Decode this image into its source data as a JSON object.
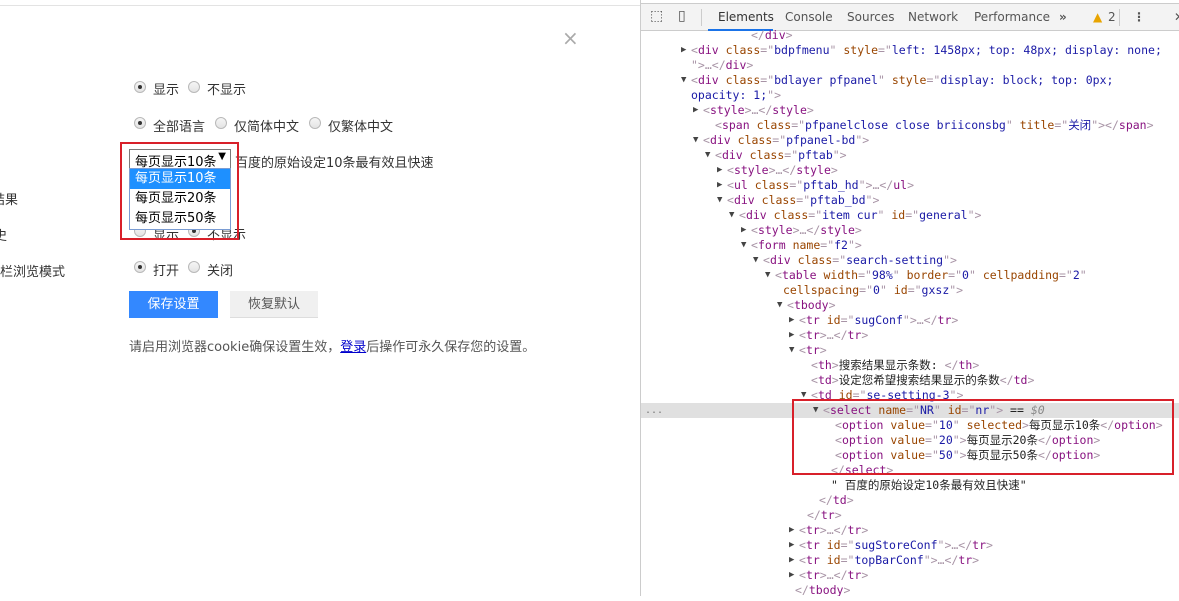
{
  "panel": {
    "close_icon": "×",
    "row_labels": [
      "结果",
      "史",
      "通栏浏览模式"
    ],
    "suggest": {
      "options": [
        "显示",
        "不显示"
      ],
      "selected": 0
    },
    "language": {
      "options": [
        "全部语言",
        "仅简体中文",
        "仅繁体中文"
      ],
      "selected": 0
    },
    "results_per_page": {
      "value": "每页显示10条",
      "options": [
        "每页显示10条",
        "每页显示20条",
        "每页显示50条"
      ],
      "highlighted": 0,
      "hint": "百度的原始设定10条最有效且快速"
    },
    "history": {
      "options": [
        "显示",
        "不显示"
      ],
      "selected": 1
    },
    "topbar": {
      "options": [
        "打开",
        "关闭"
      ],
      "selected": 0
    },
    "save_label": "保存设置",
    "reset_label": "恢复默认",
    "note_before": "请启用浏览器cookie确保设置生效，",
    "note_link": "登录",
    "note_after": "后操作可永久保存您的设置。",
    "highlight_color": "#d8202a"
  },
  "devtools": {
    "tabs": [
      "Elements",
      "Console",
      "Sources",
      "Network",
      "Performance"
    ],
    "active_tab": "Elements",
    "more": "»",
    "warnings": "2",
    "dots": "...",
    "lines": [
      {
        "i": 5,
        "a": "",
        "s": [
          [
            "p",
            "</"
          ],
          [
            "tag",
            "div"
          ],
          [
            "p",
            ">"
          ]
        ]
      },
      {
        "i": 0,
        "a": "r",
        "s": [
          [
            "p",
            "<"
          ],
          [
            "tag",
            "div "
          ],
          [
            "an",
            "class"
          ],
          [
            "p",
            "=\""
          ],
          [
            "av",
            "bdpfmenu"
          ],
          [
            "p",
            "\" "
          ],
          [
            "an",
            "style"
          ],
          [
            "p",
            "=\""
          ],
          [
            "av",
            "left: 1458px; top: 48px; display: none;"
          ]
        ]
      },
      {
        "i": 0,
        "a": "",
        "s": [
          [
            "p",
            "\">…</"
          ],
          [
            "tag",
            "div"
          ],
          [
            "p",
            ">"
          ]
        ]
      },
      {
        "i": 0,
        "a": "d",
        "s": [
          [
            "p",
            "<"
          ],
          [
            "tag",
            "div "
          ],
          [
            "an",
            "class"
          ],
          [
            "p",
            "=\""
          ],
          [
            "av",
            "bdlayer pfpanel"
          ],
          [
            "p",
            "\" "
          ],
          [
            "an",
            "style"
          ],
          [
            "p",
            "=\""
          ],
          [
            "av",
            "display: block; top: 0px;"
          ]
        ]
      },
      {
        "i": 0,
        "a": "",
        "s": [
          [
            "av",
            "opacity: 1;"
          ],
          [
            "p",
            "\">"
          ]
        ]
      },
      {
        "i": 1,
        "a": "r",
        "s": [
          [
            "p",
            "<"
          ],
          [
            "tag",
            "style"
          ],
          [
            "p",
            ">…</"
          ],
          [
            "tag",
            "style"
          ],
          [
            "p",
            ">"
          ]
        ]
      },
      {
        "i": 2,
        "a": "",
        "s": [
          [
            "p",
            "<"
          ],
          [
            "tag",
            "span "
          ],
          [
            "an",
            "class"
          ],
          [
            "p",
            "=\""
          ],
          [
            "av",
            "pfpanelclose close briiconsbg"
          ],
          [
            "p",
            "\" "
          ],
          [
            "an",
            "title"
          ],
          [
            "p",
            "=\""
          ],
          [
            "av",
            "关闭"
          ],
          [
            "p",
            "\"></"
          ],
          [
            "tag",
            "span"
          ],
          [
            "p",
            ">"
          ]
        ]
      },
      {
        "i": 1,
        "a": "d",
        "s": [
          [
            "p",
            "<"
          ],
          [
            "tag",
            "div "
          ],
          [
            "an",
            "class"
          ],
          [
            "p",
            "=\""
          ],
          [
            "av",
            "pfpanel-bd"
          ],
          [
            "p",
            "\">"
          ]
        ]
      },
      {
        "i": 2,
        "a": "d",
        "s": [
          [
            "p",
            "<"
          ],
          [
            "tag",
            "div "
          ],
          [
            "an",
            "class"
          ],
          [
            "p",
            "=\""
          ],
          [
            "av",
            "pftab"
          ],
          [
            "p",
            "\">"
          ]
        ]
      },
      {
        "i": 3,
        "a": "r",
        "s": [
          [
            "p",
            "<"
          ],
          [
            "tag",
            "style"
          ],
          [
            "p",
            ">…</"
          ],
          [
            "tag",
            "style"
          ],
          [
            "p",
            ">"
          ]
        ]
      },
      {
        "i": 3,
        "a": "r",
        "s": [
          [
            "p",
            "<"
          ],
          [
            "tag",
            "ul "
          ],
          [
            "an",
            "class"
          ],
          [
            "p",
            "=\""
          ],
          [
            "av",
            "pftab_hd"
          ],
          [
            "p",
            "\">…</"
          ],
          [
            "tag",
            "ul"
          ],
          [
            "p",
            ">"
          ]
        ]
      },
      {
        "i": 3,
        "a": "d",
        "s": [
          [
            "p",
            "<"
          ],
          [
            "tag",
            "div "
          ],
          [
            "an",
            "class"
          ],
          [
            "p",
            "=\""
          ],
          [
            "av",
            "pftab_bd"
          ],
          [
            "p",
            "\">"
          ]
        ]
      },
      {
        "i": 4,
        "a": "d",
        "s": [
          [
            "p",
            "<"
          ],
          [
            "tag",
            "div "
          ],
          [
            "an",
            "class"
          ],
          [
            "p",
            "=\""
          ],
          [
            "av",
            "item cur"
          ],
          [
            "p",
            "\" "
          ],
          [
            "an",
            "id"
          ],
          [
            "p",
            "=\""
          ],
          [
            "av",
            "general"
          ],
          [
            "p",
            "\">"
          ]
        ]
      },
      {
        "i": 5,
        "a": "r",
        "s": [
          [
            "p",
            "<"
          ],
          [
            "tag",
            "style"
          ],
          [
            "p",
            ">…</"
          ],
          [
            "tag",
            "style"
          ],
          [
            "p",
            ">"
          ]
        ]
      },
      {
        "i": 5,
        "a": "d",
        "s": [
          [
            "p",
            "<"
          ],
          [
            "tag",
            "form "
          ],
          [
            "an",
            "name"
          ],
          [
            "p",
            "=\""
          ],
          [
            "av",
            "f2"
          ],
          [
            "p",
            "\">"
          ]
        ]
      },
      {
        "i": 6,
        "a": "d",
        "s": [
          [
            "p",
            "<"
          ],
          [
            "tag",
            "div "
          ],
          [
            "an",
            "class"
          ],
          [
            "p",
            "=\""
          ],
          [
            "av",
            "search-setting"
          ],
          [
            "p",
            "\">"
          ]
        ]
      },
      {
        "i": 7,
        "a": "d",
        "s": [
          [
            "p",
            "<"
          ],
          [
            "tag",
            "table "
          ],
          [
            "an",
            "width"
          ],
          [
            "p",
            "=\""
          ],
          [
            "av",
            "98%"
          ],
          [
            "p",
            "\" "
          ],
          [
            "an",
            "border"
          ],
          [
            "p",
            "=\""
          ],
          [
            "av",
            "0"
          ],
          [
            "p",
            "\" "
          ],
          [
            "an",
            "cellpadding"
          ],
          [
            "p",
            "=\""
          ],
          [
            "av",
            "2"
          ],
          [
            "p",
            "\""
          ]
        ]
      },
      {
        "i": 7,
        "a": "",
        "x": 8,
        "s": [
          [
            "an",
            "cellspacing"
          ],
          [
            "p",
            "=\""
          ],
          [
            "av",
            "0"
          ],
          [
            "p",
            "\" "
          ],
          [
            "an",
            "id"
          ],
          [
            "p",
            "=\""
          ],
          [
            "av",
            "gxsz"
          ],
          [
            "p",
            "\">"
          ]
        ]
      },
      {
        "i": 8,
        "a": "d",
        "s": [
          [
            "p",
            "<"
          ],
          [
            "tag",
            "tbody"
          ],
          [
            "p",
            ">"
          ]
        ]
      },
      {
        "i": 9,
        "a": "r",
        "s": [
          [
            "p",
            "<"
          ],
          [
            "tag",
            "tr "
          ],
          [
            "an",
            "id"
          ],
          [
            "p",
            "=\""
          ],
          [
            "av",
            "sugConf"
          ],
          [
            "p",
            "\">…</"
          ],
          [
            "tag",
            "tr"
          ],
          [
            "p",
            ">"
          ]
        ]
      },
      {
        "i": 9,
        "a": "r",
        "s": [
          [
            "p",
            "<"
          ],
          [
            "tag",
            "tr"
          ],
          [
            "p",
            ">…</"
          ],
          [
            "tag",
            "tr"
          ],
          [
            "p",
            ">"
          ]
        ]
      },
      {
        "i": 9,
        "a": "d",
        "s": [
          [
            "p",
            "<"
          ],
          [
            "tag",
            "tr"
          ],
          [
            "p",
            ">"
          ]
        ]
      },
      {
        "i": 10,
        "a": "",
        "s": [
          [
            "p",
            "<"
          ],
          [
            "tag",
            "th"
          ],
          [
            "p",
            ">"
          ],
          [
            "tx",
            "搜索结果显示条数: "
          ],
          [
            "p",
            "</"
          ],
          [
            "tag",
            "th"
          ],
          [
            "p",
            ">"
          ]
        ]
      },
      {
        "i": 10,
        "a": "",
        "s": [
          [
            "p",
            "<"
          ],
          [
            "tag",
            "td"
          ],
          [
            "p",
            ">"
          ],
          [
            "tx",
            "设定您希望搜索结果显示的条数"
          ],
          [
            "p",
            "</"
          ],
          [
            "tag",
            "td"
          ],
          [
            "p",
            ">"
          ]
        ]
      },
      {
        "i": 10,
        "a": "d",
        "s": [
          [
            "p",
            "<"
          ],
          [
            "tag",
            "td "
          ],
          [
            "an",
            "id"
          ],
          [
            "p",
            "=\""
          ],
          [
            "av",
            "se-setting-3"
          ],
          [
            "p",
            "\">"
          ]
        ]
      },
      {
        "i": 11,
        "a": "d",
        "sel": true,
        "s": [
          [
            "p",
            "<"
          ],
          [
            "tag",
            "select "
          ],
          [
            "an",
            "name"
          ],
          [
            "p",
            "=\""
          ],
          [
            "av",
            "NR"
          ],
          [
            "p",
            "\" "
          ],
          [
            "an",
            "id"
          ],
          [
            "p",
            "=\""
          ],
          [
            "av",
            "nr"
          ],
          [
            "p",
            "\">"
          ],
          [
            "tx",
            " == "
          ],
          [
            "dl",
            "$0"
          ]
        ]
      },
      {
        "i": 12,
        "a": "",
        "s": [
          [
            "p",
            "<"
          ],
          [
            "tag",
            "option "
          ],
          [
            "an",
            "value"
          ],
          [
            "p",
            "=\""
          ],
          [
            "av",
            "10"
          ],
          [
            "p",
            "\" "
          ],
          [
            "an",
            "selected"
          ],
          [
            "p",
            ">"
          ],
          [
            "tx",
            "每页显示10条"
          ],
          [
            "p",
            "</"
          ],
          [
            "tag",
            "option"
          ],
          [
            "p",
            ">"
          ]
        ]
      },
      {
        "i": 12,
        "a": "",
        "s": [
          [
            "p",
            "<"
          ],
          [
            "tag",
            "option "
          ],
          [
            "an",
            "value"
          ],
          [
            "p",
            "=\""
          ],
          [
            "av",
            "20"
          ],
          [
            "p",
            "\">"
          ],
          [
            "tx",
            "每页显示20条"
          ],
          [
            "p",
            "</"
          ],
          [
            "tag",
            "option"
          ],
          [
            "p",
            ">"
          ]
        ]
      },
      {
        "i": 12,
        "a": "",
        "s": [
          [
            "p",
            "<"
          ],
          [
            "tag",
            "option "
          ],
          [
            "an",
            "value"
          ],
          [
            "p",
            "=\""
          ],
          [
            "av",
            "50"
          ],
          [
            "p",
            "\">"
          ],
          [
            "tx",
            "每页显示50条"
          ],
          [
            "p",
            "</"
          ],
          [
            "tag",
            "option"
          ],
          [
            "p",
            ">"
          ]
        ]
      },
      {
        "i": 11,
        "a": "",
        "x": 8,
        "s": [
          [
            "p",
            "</"
          ],
          [
            "tag",
            "select"
          ],
          [
            "p",
            ">"
          ]
        ]
      },
      {
        "i": 11,
        "a": "",
        "x": 8,
        "s": [
          [
            "tx",
            "\" 百度的原始设定10条最有效且快速\""
          ]
        ]
      },
      {
        "i": 10,
        "a": "",
        "x": 8,
        "s": [
          [
            "p",
            "</"
          ],
          [
            "tag",
            "td"
          ],
          [
            "p",
            ">"
          ]
        ]
      },
      {
        "i": 9,
        "a": "",
        "x": 8,
        "s": [
          [
            "p",
            "</"
          ],
          [
            "tag",
            "tr"
          ],
          [
            "p",
            ">"
          ]
        ]
      },
      {
        "i": 9,
        "a": "r",
        "s": [
          [
            "p",
            "<"
          ],
          [
            "tag",
            "tr"
          ],
          [
            "p",
            ">…</"
          ],
          [
            "tag",
            "tr"
          ],
          [
            "p",
            ">"
          ]
        ]
      },
      {
        "i": 9,
        "a": "r",
        "s": [
          [
            "p",
            "<"
          ],
          [
            "tag",
            "tr "
          ],
          [
            "an",
            "id"
          ],
          [
            "p",
            "=\""
          ],
          [
            "av",
            "sugStoreConf"
          ],
          [
            "p",
            "\">…</"
          ],
          [
            "tag",
            "tr"
          ],
          [
            "p",
            ">"
          ]
        ]
      },
      {
        "i": 9,
        "a": "r",
        "s": [
          [
            "p",
            "<"
          ],
          [
            "tag",
            "tr "
          ],
          [
            "an",
            "id"
          ],
          [
            "p",
            "=\""
          ],
          [
            "av",
            "topBarConf"
          ],
          [
            "p",
            "\">…</"
          ],
          [
            "tag",
            "tr"
          ],
          [
            "p",
            ">"
          ]
        ]
      },
      {
        "i": 9,
        "a": "r",
        "s": [
          [
            "p",
            "<"
          ],
          [
            "tag",
            "tr"
          ],
          [
            "p",
            ">…</"
          ],
          [
            "tag",
            "tr"
          ],
          [
            "p",
            ">"
          ]
        ]
      },
      {
        "i": 8,
        "a": "",
        "x": 8,
        "s": [
          [
            "p",
            "</"
          ],
          [
            "tag",
            "tbody"
          ],
          [
            "p",
            ">"
          ]
        ]
      }
    ]
  }
}
